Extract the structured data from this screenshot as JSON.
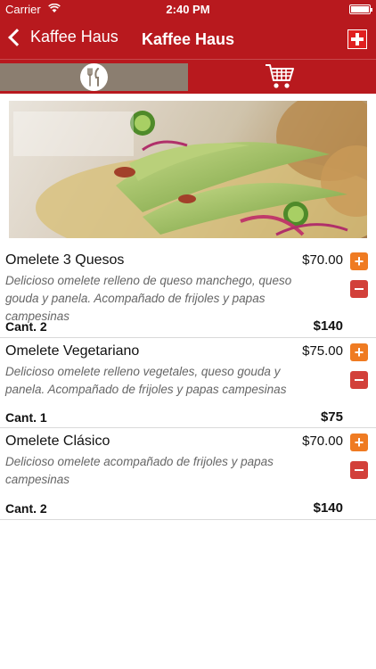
{
  "status_bar": {
    "carrier": "Carrier",
    "time": "2:40 PM"
  },
  "nav": {
    "back_label": "Kaffee Haus",
    "title": "Kaffee Haus"
  },
  "tabs": [
    {
      "name": "menu",
      "icon": "cutlery-icon",
      "selected": true
    },
    {
      "name": "cart",
      "icon": "cart-icon",
      "selected": false
    }
  ],
  "colors": {
    "brand_red": "#b8191e",
    "add_orange": "#ef7b22",
    "remove_red": "#d2403a",
    "selected_tab": "#8b7e70"
  },
  "items": [
    {
      "name": "Omelete 3 Quesos",
      "price": "$70.00",
      "description": "Delicioso omelete relleno de queso manchego, queso gouda y panela. Acompañado de frijoles y papas campesinas",
      "qty": "Cant. 2",
      "subtotal": "$140"
    },
    {
      "name": "Omelete Vegetariano",
      "price": "$75.00",
      "description": "Delicioso omelete relleno vegetales, queso gouda y panela. Acompañado de frijoles y papas campesinas",
      "qty": "Cant. 1",
      "subtotal": "$75"
    },
    {
      "name": "Omelete Clásico",
      "price": "$70.00",
      "description": "Delicioso omelete acompañado de frijoles y papas campesinas",
      "qty": "Cant. 2",
      "subtotal": "$140"
    }
  ]
}
